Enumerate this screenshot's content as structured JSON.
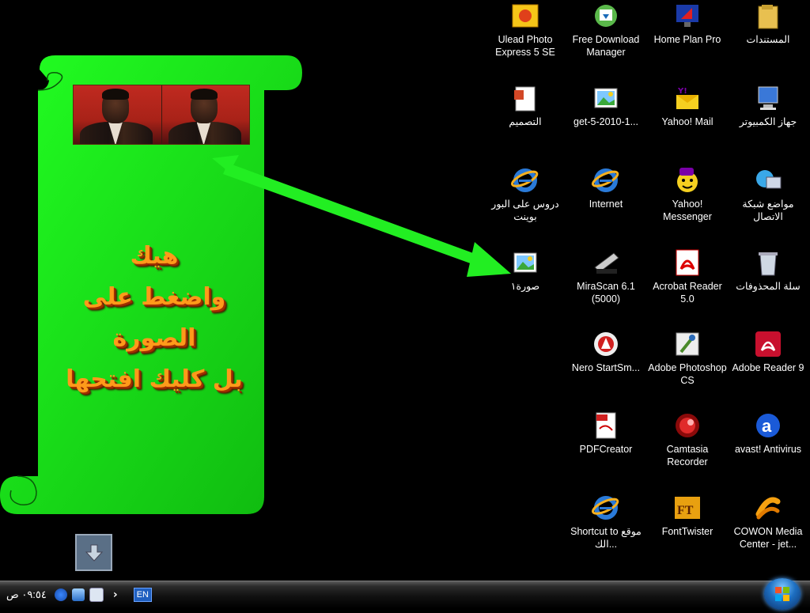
{
  "banner": {
    "lines": [
      "هيك",
      "واضغط على الصورة",
      "بل كليك افتحها"
    ]
  },
  "desktop_icons": [
    {
      "label": "Ulead Photo Express 5 SE",
      "icon": "ulead-icon"
    },
    {
      "label": "Free Download Manager",
      "icon": "fdm-icon"
    },
    {
      "label": "Home Plan Pro",
      "icon": "homeplan-icon"
    },
    {
      "label": "المستندات",
      "icon": "folder-icon"
    },
    {
      "label": "التصميم",
      "icon": "powerpoint-icon"
    },
    {
      "label": "get-5-2010-1...",
      "icon": "image-icon"
    },
    {
      "label": "Yahoo! Mail",
      "icon": "yahoo-mail-icon"
    },
    {
      "label": "جهاز الكمبيوتر",
      "icon": "computer-icon"
    },
    {
      "label": "دروس على البور بوينت",
      "icon": "ie-icon"
    },
    {
      "label": "Internet",
      "icon": "ie-icon"
    },
    {
      "label": "Yahoo! Messenger",
      "icon": "yahoo-messenger-icon"
    },
    {
      "label": "مواضع شبكة الاتصال",
      "icon": "network-icon"
    },
    {
      "label": "صورة١",
      "icon": "image-icon"
    },
    {
      "label": "MiraScan 6.1 (5000)",
      "icon": "scanner-icon"
    },
    {
      "label": "Acrobat Reader 5.0",
      "icon": "acrobat-icon"
    },
    {
      "label": "سلة المحذوفات",
      "icon": "recycle-bin-icon"
    },
    {
      "label": "Nero StartSm...",
      "icon": "nero-icon"
    },
    {
      "label": "Adobe Photoshop CS",
      "icon": "photoshop-icon"
    },
    {
      "label": "Adobe Reader 9",
      "icon": "adobe-reader-icon"
    },
    {
      "label": "PDFCreator",
      "icon": "pdfcreator-icon"
    },
    {
      "label": "Camtasia Recorder",
      "icon": "camtasia-icon"
    },
    {
      "label": "avast! Antivirus",
      "icon": "avast-icon"
    },
    {
      "label": "Shortcut to موقع الك...",
      "icon": "ie-icon"
    },
    {
      "label": "FontTwister",
      "icon": "fonttwister-icon"
    },
    {
      "label": "COWON Media Center - jet...",
      "icon": "cowon-icon"
    }
  ],
  "taskbar": {
    "clock": "٠٩:٥٤ ص",
    "language": "EN",
    "tray_icons": [
      "avast-tray-icon",
      "network-tray-icon",
      "monitor-tray-icon"
    ]
  },
  "colors": {
    "banner_green": "#1ee81e",
    "arrow_green": "#22ee22",
    "text_orange": "#ff9a1a"
  }
}
